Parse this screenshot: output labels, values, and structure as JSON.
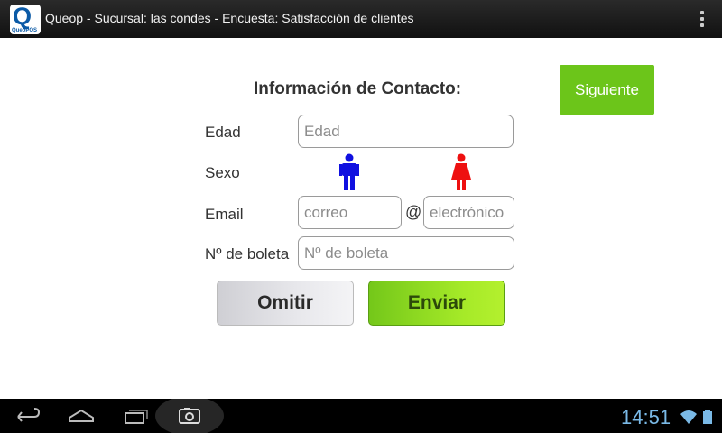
{
  "app": {
    "logo_letter": "Q",
    "logo_sub": "QueoPOS",
    "title": "Queop - Sucursal: las condes - Encuesta: Satisfacción de clientes"
  },
  "form": {
    "heading": "Información de Contacto:",
    "next_label": "Siguiente",
    "age": {
      "label": "Edad",
      "placeholder": "Edad"
    },
    "gender": {
      "label": "Sexo",
      "male_color": "#1010e0",
      "female_color": "#ee1010"
    },
    "email": {
      "label": "Email",
      "user_placeholder": "correo",
      "at": "@",
      "domain_placeholder": "electrónico"
    },
    "receipt": {
      "label": "Nº de boleta",
      "placeholder": "Nº de boleta"
    },
    "omit_label": "Omitir",
    "send_label": "Enviar"
  },
  "system_bar": {
    "time": "14:51",
    "icons": [
      "back-icon",
      "home-icon",
      "recent-apps-icon",
      "screenshot-icon",
      "wifi-icon",
      "battery-icon"
    ]
  },
  "colors": {
    "accent_green": "#6cc51a",
    "clock_blue": "#7ab9e6"
  }
}
